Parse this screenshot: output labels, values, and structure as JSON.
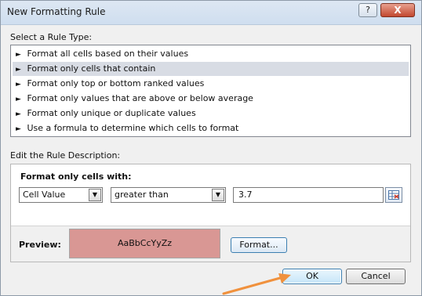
{
  "window": {
    "title": "New Formatting Rule",
    "help_label": "?",
    "close_label": "X"
  },
  "rule_type": {
    "label": "Select a Rule Type:",
    "items": [
      "Format all cells based on their values",
      "Format only cells that contain",
      "Format only top or bottom ranked values",
      "Format only values that are above or below average",
      "Format only unique or duplicate values",
      "Use a formula to determine which cells to format"
    ],
    "selected_index": 1
  },
  "description": {
    "label": "Edit the Rule Description:",
    "format_label": "Format only cells with:",
    "condition_1": "Cell Value",
    "condition_2": "greater than",
    "value": "3.7",
    "preview_label": "Preview:",
    "preview_text": "AaBbCcYyZz",
    "preview_fill": "#d99794",
    "format_button": "Format..."
  },
  "buttons": {
    "ok": "OK",
    "cancel": "Cancel"
  },
  "icons": {
    "list_arrow": "►",
    "dropdown": "▼",
    "range_selector": "range-selector-icon"
  },
  "colors": {
    "selected_row": "#d8dce4",
    "annotation_arrow": "#f0913d"
  }
}
